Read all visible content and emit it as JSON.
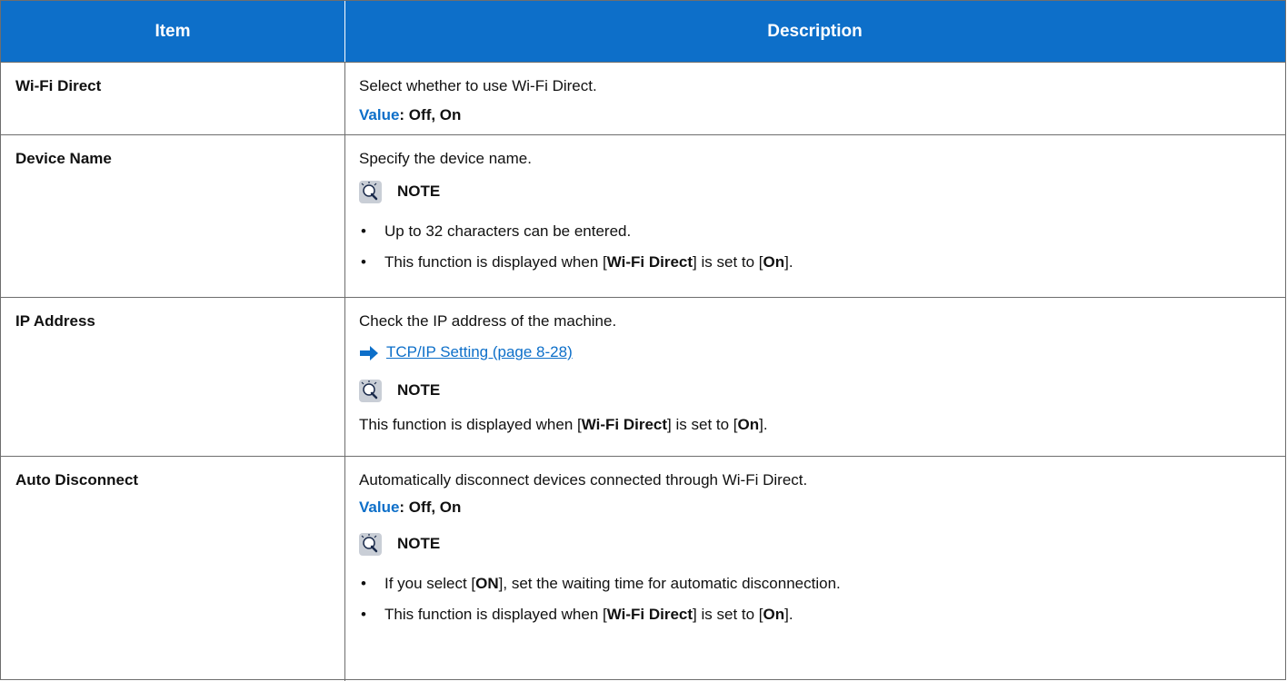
{
  "colors": {
    "header_bg": "#0d6fc9",
    "accent": "#0d6fc9",
    "border": "#6e6e6e"
  },
  "table": {
    "headers": {
      "item": "Item",
      "description": "Description"
    },
    "rows": [
      {
        "item": "Wi-Fi Direct",
        "text": "Select whether to use Wi-Fi Direct.",
        "value_label": "Value",
        "value_options": ": Off, On"
      },
      {
        "item": "Device Name",
        "text": "Specify the device name.",
        "note_title": "NOTE",
        "bullets": [
          "Up to 32 characters can be entered.",
          {
            "pre": "This function is displayed when [",
            "b1": "Wi-Fi Direct",
            "mid": "] is set to [",
            "b2": "On",
            "post": "]."
          }
        ]
      },
      {
        "item": "IP Address",
        "text": "Check the IP address of the machine.",
        "link_text": "TCP/IP Setting (page 8-28)",
        "link_icon": "arrow-right-icon",
        "note_title": "NOTE",
        "note_text": {
          "pre": "This function is displayed when [",
          "b1": "Wi-Fi Direct",
          "mid": "] is set to [",
          "b2": "On",
          "post": "]."
        }
      },
      {
        "item": "Auto Disconnect",
        "text": "Automatically disconnect devices connected through Wi-Fi Direct.",
        "value_label": "Value",
        "value_options": ": Off, On",
        "note_title": "NOTE",
        "bullets": [
          {
            "pre": "If you select [",
            "b1": "ON",
            "post": "], set the waiting time for automatic disconnection."
          },
          {
            "pre": "This function is displayed when [",
            "b1": "Wi-Fi Direct",
            "mid": "] is set to [",
            "b2": "On",
            "post": "]."
          }
        ]
      }
    ]
  },
  "bullet_char": "•",
  "note_icon": "lightbulb-note-icon"
}
